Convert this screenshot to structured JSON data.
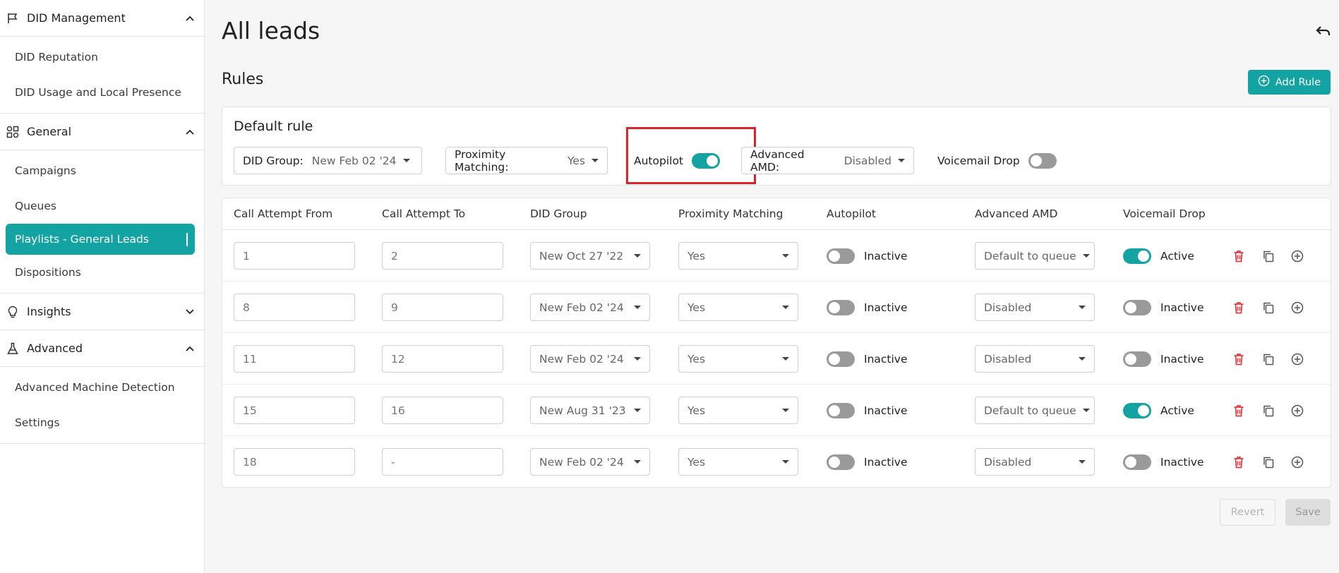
{
  "sidebar": {
    "sections": [
      {
        "label": "DID Management",
        "icon": "flag-icon",
        "expanded": true,
        "items": [
          "DID Reputation",
          "DID Usage and Local Presence"
        ]
      },
      {
        "label": "General",
        "icon": "shapes-icon",
        "expanded": true,
        "items": [
          "Campaigns",
          "Queues",
          "Playlists - General Leads",
          "Dispositions"
        ],
        "active_item": "Playlists - General Leads"
      },
      {
        "label": "Insights",
        "icon": "lightbulb-icon",
        "expanded": false,
        "items": []
      },
      {
        "label": "Advanced",
        "icon": "flask-icon",
        "expanded": true,
        "items": [
          "Advanced Machine Detection",
          "Settings"
        ]
      }
    ]
  },
  "page": {
    "title": "All leads",
    "undo_icon": "undo-icon"
  },
  "rules": {
    "title": "Rules",
    "add_label": "Add Rule",
    "default": {
      "title": "Default rule",
      "did_group_label": "DID Group:",
      "did_group_value": "New Feb 02 '24",
      "proximity_label": "Proximity Matching:",
      "proximity_value": "Yes",
      "autopilot_label": "Autopilot",
      "autopilot_on": true,
      "amd_label": "Advanced AMD:",
      "amd_value": "Disabled",
      "voicemail_label": "Voicemail Drop",
      "voicemail_on": false
    },
    "columns": [
      "Call Attempt From",
      "Call Attempt To",
      "DID Group",
      "Proximity Matching",
      "Autopilot",
      "Advanced AMD",
      "Voicemail Drop"
    ],
    "rows": [
      {
        "from": "1",
        "to": "2",
        "did_group": "New Oct 27 '22",
        "proximity": "Yes",
        "autopilot": "Inactive",
        "autopilot_on": false,
        "amd": "Default to queue",
        "voicemail": "Active",
        "voicemail_on": true
      },
      {
        "from": "8",
        "to": "9",
        "did_group": "New Feb 02 '24",
        "proximity": "Yes",
        "autopilot": "Inactive",
        "autopilot_on": false,
        "amd": "Disabled",
        "voicemail": "Inactive",
        "voicemail_on": false
      },
      {
        "from": "11",
        "to": "12",
        "did_group": "New Feb 02 '24",
        "proximity": "Yes",
        "autopilot": "Inactive",
        "autopilot_on": false,
        "amd": "Disabled",
        "voicemail": "Inactive",
        "voicemail_on": false
      },
      {
        "from": "15",
        "to": "16",
        "did_group": "New Aug 31 '23",
        "proximity": "Yes",
        "autopilot": "Inactive",
        "autopilot_on": false,
        "amd": "Default to queue",
        "voicemail": "Active",
        "voicemail_on": true
      },
      {
        "from": "18",
        "to": "-",
        "did_group": "New Feb 02 '24",
        "proximity": "Yes",
        "autopilot": "Inactive",
        "autopilot_on": false,
        "amd": "Disabled",
        "voicemail": "Inactive",
        "voicemail_on": false
      }
    ],
    "row_action_icons": [
      "trash-icon",
      "copy-icon",
      "plus-circle-icon"
    ],
    "revert_label": "Revert",
    "save_label": "Save"
  },
  "colors": {
    "accent": "#13a3a3",
    "delete": "#e0393e",
    "highlight": "#d9252a",
    "toggle_off": "#9a9a9a"
  }
}
